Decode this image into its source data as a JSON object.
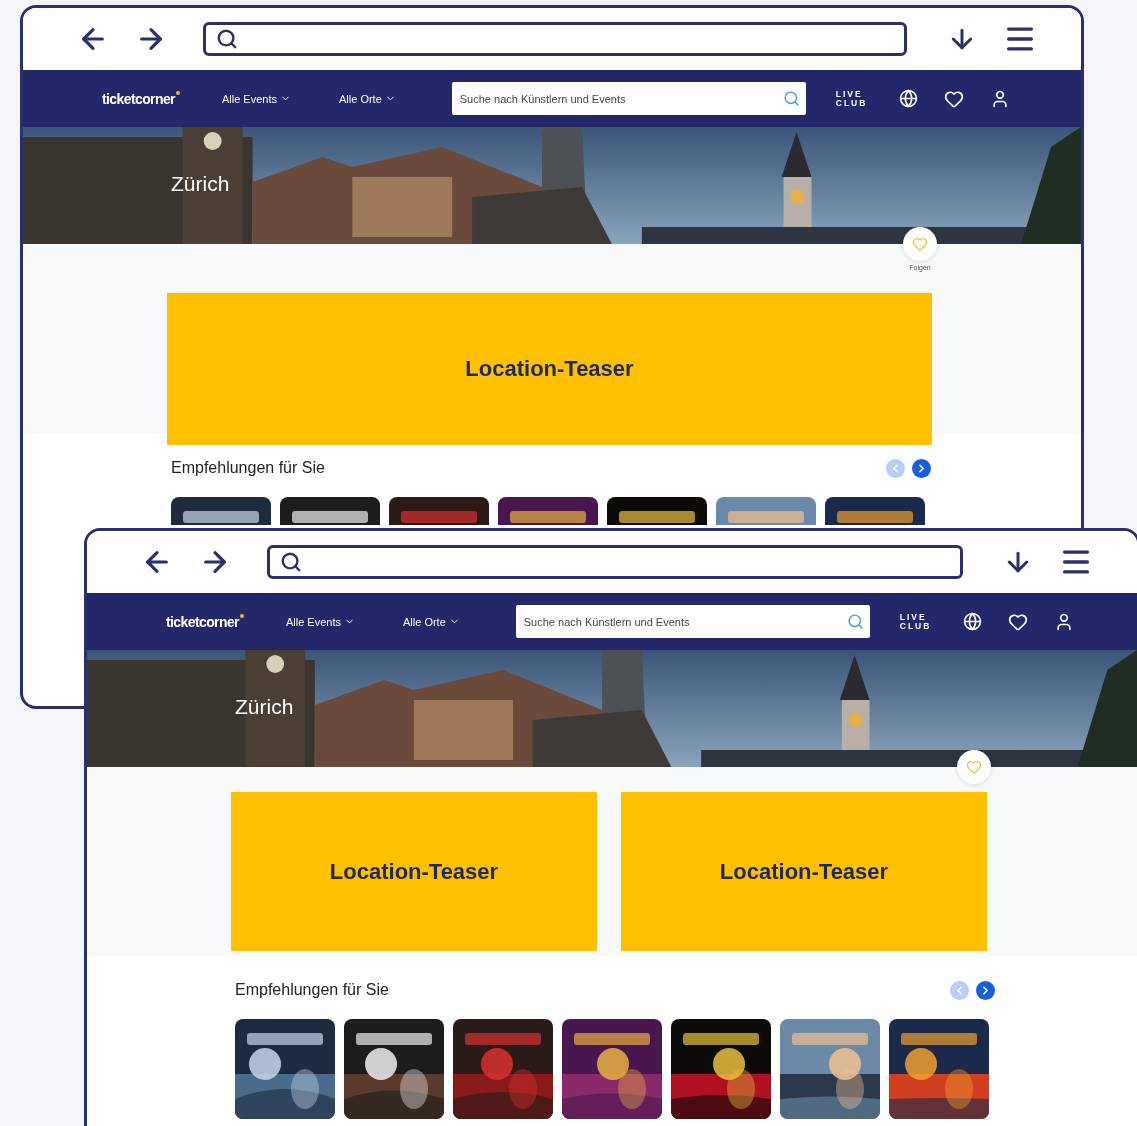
{
  "windows": [
    {
      "nav": {
        "logo": "ticketcorner",
        "menus": [
          {
            "label": "Alle Events"
          },
          {
            "label": "Alle Orte"
          }
        ],
        "search": {
          "placeholder": "Suche nach Künstlern und Events"
        },
        "club": [
          "LIVE",
          "CLUB"
        ]
      },
      "hero": {
        "city": "Zürich",
        "kind": "picture"
      },
      "follow": {
        "label": "Folgen"
      },
      "teasers": [
        {
          "label": "Location-Teaser"
        }
      ],
      "recommendations": {
        "title": "Empfehlungen für Sie",
        "prev_disabled": true,
        "next_disabled": false
      }
    },
    {
      "nav": {
        "logo": "ticketcorner",
        "menus": [
          {
            "label": "Alle Events"
          },
          {
            "label": "Alle Orte"
          }
        ],
        "search": {
          "placeholder": "Suche nach Künstlern und Events"
        },
        "club": [
          "LIVE",
          "CLUB"
        ]
      },
      "hero": {
        "city": "Zürich",
        "kind": "picture"
      },
      "teasers": [
        {
          "label": "Location-Teaser"
        },
        {
          "label": "Location-Teaser"
        }
      ],
      "recommendations": {
        "title": "Empfehlungen für Sie",
        "prev_disabled": true,
        "next_disabled": false
      }
    }
  ]
}
